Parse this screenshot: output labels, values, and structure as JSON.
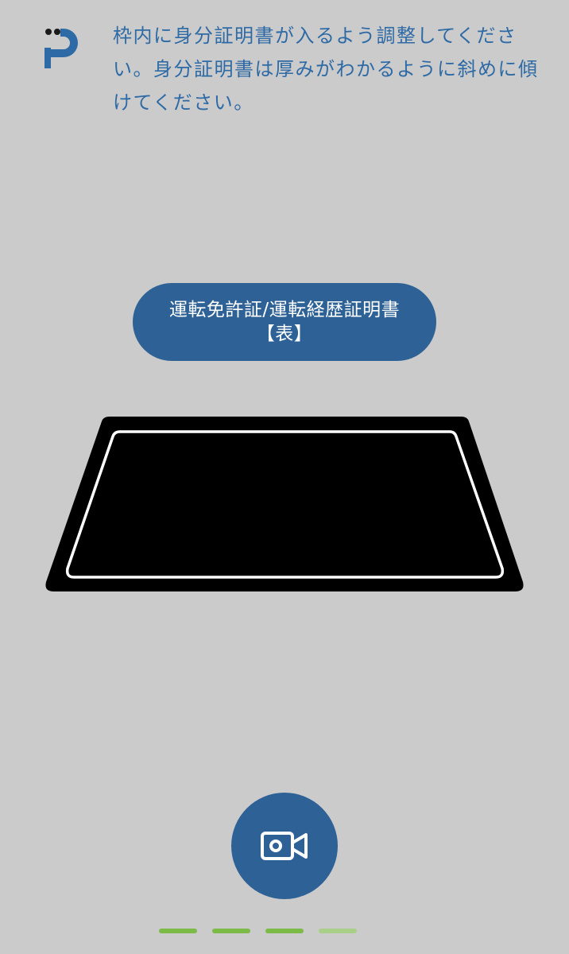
{
  "instruction": {
    "text": "枠内に身分証明書が入るよう調整してください。身分証明書は厚みがわかるように斜めに傾けてください。"
  },
  "document_type": {
    "line1": "運転免許証/運転経歴証明書",
    "line2": "【表】"
  },
  "icons": {
    "logo": "brand-logo",
    "capture": "video-camera-icon"
  },
  "progress": {
    "total_steps": 4,
    "completed_steps": 3,
    "steps": [
      {
        "state": "done"
      },
      {
        "state": "done"
      },
      {
        "state": "done"
      },
      {
        "state": "current"
      }
    ]
  },
  "colors": {
    "background": "#cbcbcb",
    "accent": "#2e6296",
    "instruction_text": "#2e6aa5",
    "progress_done": "#7dbb48",
    "progress_current": "#a9cf88"
  }
}
